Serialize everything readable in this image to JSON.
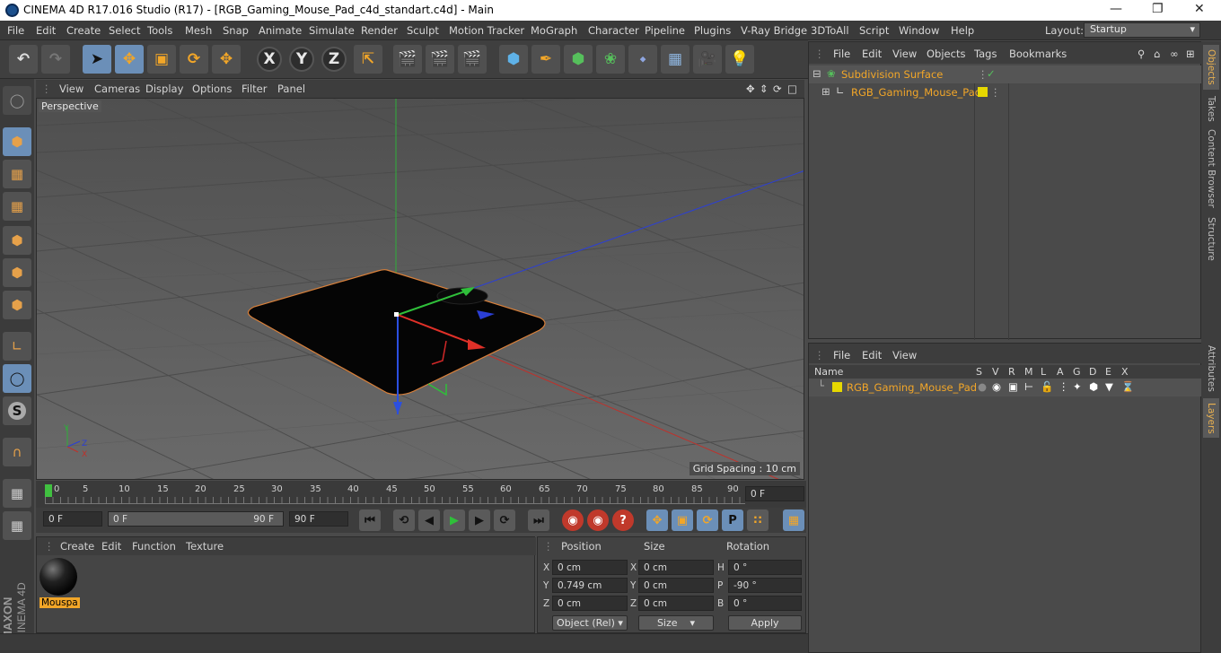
{
  "window": {
    "title": "CINEMA 4D R17.016 Studio (R17) - [RGB_Gaming_Mouse_Pad_c4d_standart.c4d] - Main"
  },
  "menu": [
    "File",
    "Edit",
    "Create",
    "Select",
    "Tools",
    "Mesh",
    "Snap",
    "Animate",
    "Simulate",
    "Render",
    "Sculpt",
    "Motion Tracker",
    "MoGraph",
    "Character",
    "Pipeline",
    "Plugins",
    "V-Ray Bridge",
    "3DToAll",
    "Script",
    "Window",
    "Help"
  ],
  "layout": {
    "label": "Layout:",
    "value": "Startup"
  },
  "toolbar": {
    "x": "X",
    "y": "Y",
    "z": "Z"
  },
  "viewport": {
    "menu": [
      "View",
      "Cameras",
      "Display",
      "Options",
      "Filter",
      "Panel"
    ],
    "camera_label": "Perspective",
    "grid_spacing": "Grid Spacing : 10 cm"
  },
  "timeline": {
    "ticks": [
      "0",
      "5",
      "10",
      "15",
      "20",
      "25",
      "30",
      "35",
      "40",
      "45",
      "50",
      "55",
      "60",
      "65",
      "70",
      "75",
      "80",
      "85",
      "90"
    ],
    "current_frame": "0 F"
  },
  "transport": {
    "start": "0 F",
    "range_start": "0 F",
    "range_end": "90 F",
    "end": "90 F"
  },
  "material": {
    "menu": [
      "Create",
      "Edit",
      "Function",
      "Texture"
    ],
    "item_label": "Mouspa"
  },
  "coords": {
    "headers": {
      "position": "Position",
      "size": "Size",
      "rotation": "Rotation"
    },
    "pos": {
      "x_label": "X",
      "x": "0 cm",
      "y_label": "Y",
      "y": "0.749 cm",
      "z_label": "Z",
      "z": "0 cm"
    },
    "size": {
      "x_label": "X",
      "x": "0 cm",
      "y_label": "Y",
      "y": "0 cm",
      "z_label": "Z",
      "z": "0 cm"
    },
    "rot": {
      "h_label": "H",
      "h": "0 °",
      "p_label": "P",
      "p": "-90 °",
      "b_label": "B",
      "b": "0 °"
    },
    "mode": "Object (Rel)",
    "size_mode": "Size",
    "apply": "Apply"
  },
  "objects": {
    "menu": [
      "File",
      "Edit",
      "View",
      "Objects",
      "Tags",
      "Bookmarks"
    ],
    "items": [
      {
        "name": "Subdivision Surface"
      },
      {
        "name": "RGB_Gaming_Mouse_Pad"
      }
    ]
  },
  "layers": {
    "menu": [
      "File",
      "Edit",
      "View"
    ],
    "columns": [
      "Name",
      "S",
      "V",
      "R",
      "M",
      "L",
      "A",
      "G",
      "D",
      "E",
      "X"
    ],
    "row": "RGB_Gaming_Mouse_Pad"
  },
  "right_tabs": [
    "Objects",
    "Takes",
    "Content Browser",
    "Structure",
    "Attributes",
    "Layers"
  ],
  "colors": {
    "accent": "#f2a628",
    "selected_tool": "#6b8fb8",
    "viewport_bg": "#5a5a5a"
  }
}
